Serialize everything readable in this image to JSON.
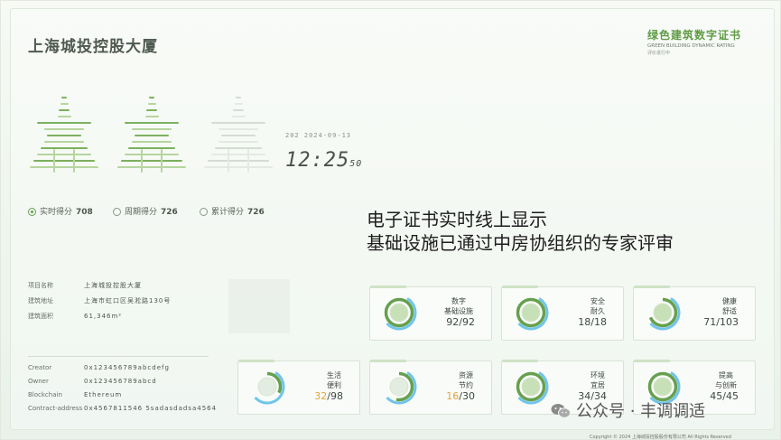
{
  "title": "上海城投控股大厦",
  "certificate": {
    "title_cn": "绿色建筑数字证书",
    "title_en": "GREEN BUILDING DYNAMIC RATING",
    "subtitle": "评价进行中"
  },
  "rating": {
    "stars_filled": 2,
    "stars_total": 3
  },
  "datetime": {
    "date": "202  2024-09-13",
    "time": "12:25",
    "seconds": "50"
  },
  "scores": [
    {
      "label": "实时得分",
      "value": "708",
      "selected": true
    },
    {
      "label": "周期得分",
      "value": "726",
      "selected": false
    },
    {
      "label": "累计得分",
      "value": "726",
      "selected": false
    }
  ],
  "headline": {
    "line1": "电子证书实时线上显示",
    "line2": "基础设施已通过中房协组织的专家评审"
  },
  "project_info": [
    {
      "key": "项目名称",
      "value": "上海城投控股大厦"
    },
    {
      "key": "建筑地址",
      "value": "上海市虹口区吴淞路130号"
    },
    {
      "key": "建筑面积",
      "value": "61,346m²"
    }
  ],
  "chain_info": [
    {
      "key": "Creator",
      "value": "0x123456789abcdefg"
    },
    {
      "key": "Owner",
      "value": "0x123456789abcd"
    },
    {
      "key": "Blockchain",
      "value": "Ethereum"
    },
    {
      "key": "Contract-address",
      "value": "0x4567811546 5sadasdadsa4564"
    }
  ],
  "categories": [
    {
      "name1": "数字",
      "name2": "基础设施",
      "got": 92,
      "total": 92,
      "low": false
    },
    {
      "name1": "安全",
      "name2": "耐久",
      "got": 18,
      "total": 18,
      "low": false
    },
    {
      "name1": "健康",
      "name2": "舒适",
      "got": 71,
      "total": 103,
      "low": false
    },
    {
      "name1": "生活",
      "name2": "便利",
      "got": 32,
      "total": 98,
      "low": true
    },
    {
      "name1": "资源",
      "name2": "节约",
      "got": 16,
      "total": 30,
      "low": true
    },
    {
      "name1": "环境",
      "name2": "宜居",
      "got": 34,
      "total": 34,
      "low": false
    },
    {
      "name1": "提高",
      "name2": "与创新",
      "got": 45,
      "total": 45,
      "low": false
    }
  ],
  "watermark": "公众号 · 丰调调适",
  "copyright": "Copyright © 2024  上海城投控股股份有限公司 All Rights Reserved",
  "colors": {
    "accent": "#66a04e",
    "ring_blue": "#4fb7e6",
    "low": "#e6a53a"
  }
}
